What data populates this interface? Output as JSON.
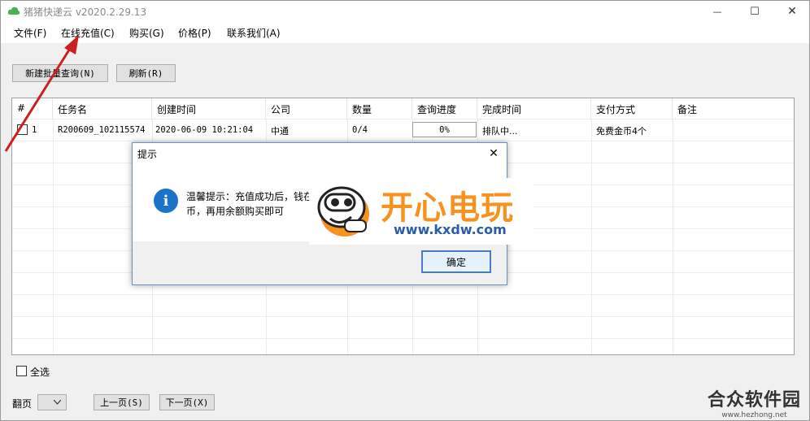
{
  "window": {
    "title": "猪猪快递云 v2020.2.29.13",
    "controls": {
      "minimize": "—",
      "maximize": "☐",
      "close": "✕"
    }
  },
  "menu": {
    "items": [
      "文件(F)",
      "在线充值(C)",
      "购买(G)",
      "价格(P)",
      "联系我们(A)"
    ]
  },
  "toolbar": {
    "new_batch_label": "新建批量查询(N)",
    "refresh_label": "刷新(R)"
  },
  "grid": {
    "columns": [
      "#",
      "任务名",
      "创建时间",
      "公司",
      "数量",
      "查询进度",
      "完成时间",
      "支付方式",
      "备注"
    ],
    "rows": [
      {
        "index": "1",
        "task_name": "R200609_102115574",
        "created": "2020-06-09 10:21:04",
        "company": "中通",
        "count": "0/4",
        "progress": "0%",
        "finish": "排队中...",
        "payment": "免费金币4个",
        "note": ""
      }
    ]
  },
  "footer": {
    "select_all_label": "全选",
    "page_label": "翻页",
    "prev_label": "上一页(S)",
    "next_label": "下一页(X)"
  },
  "dialog": {
    "title": "提示",
    "close": "✕",
    "message_line1": "温馨提示：充值成功后，钱在",
    "message_line2": "币，再用余额购买即可",
    "ok_label": "确定",
    "info_glyph": "i"
  },
  "watermark": {
    "brand": "开心电玩",
    "url": "www.kxdw.com"
  },
  "site_mark": {
    "name": "合众软件园",
    "url": "www.hezhong.net"
  },
  "colors": {
    "accent_blue": "#1a73c9",
    "watermark_orange": "#f6921e",
    "arrow_red": "#cc1f1f"
  }
}
